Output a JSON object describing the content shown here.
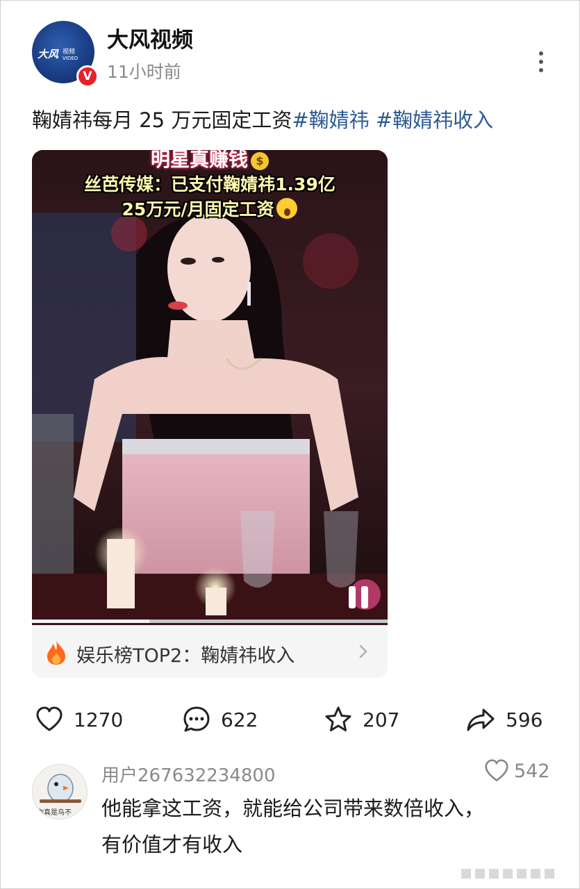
{
  "post": {
    "account_name": "大风视频",
    "time": "11小时前",
    "avatar_logo": "大风 视频 VIDEO",
    "verified_badge": "V",
    "text_main": "鞠婧祎每月 25 万元固定工资",
    "hashtags": [
      "#鞠婧祎",
      "#鞠婧祎收入"
    ],
    "more_icon": "more-vertical-icon"
  },
  "video": {
    "caption_top": "明星真赚钱",
    "caption_line1": "丝芭传媒：已支付鞠婧祎1.39亿",
    "caption_line2": "25万元/月固定工资",
    "progress_fraction": 0.33,
    "pause_icon": "pause-icon"
  },
  "trending": {
    "icon": "flame-icon",
    "text": "娱乐榜TOP2：鞠婧祎收入"
  },
  "actions": {
    "likes": "1270",
    "comments": "622",
    "favorites": "207",
    "shares": "596"
  },
  "comment": {
    "user": "用户267632234800",
    "likes": "542",
    "avatar_text": "你真是鸟不",
    "line1": "他能拿这工资，就能给公司带来数倍收入，",
    "line2": "有价值才有收入"
  },
  "colors": {
    "hashtag": "#2b5a95",
    "verified": "#e8202a",
    "flame": "#ff6a1a"
  }
}
